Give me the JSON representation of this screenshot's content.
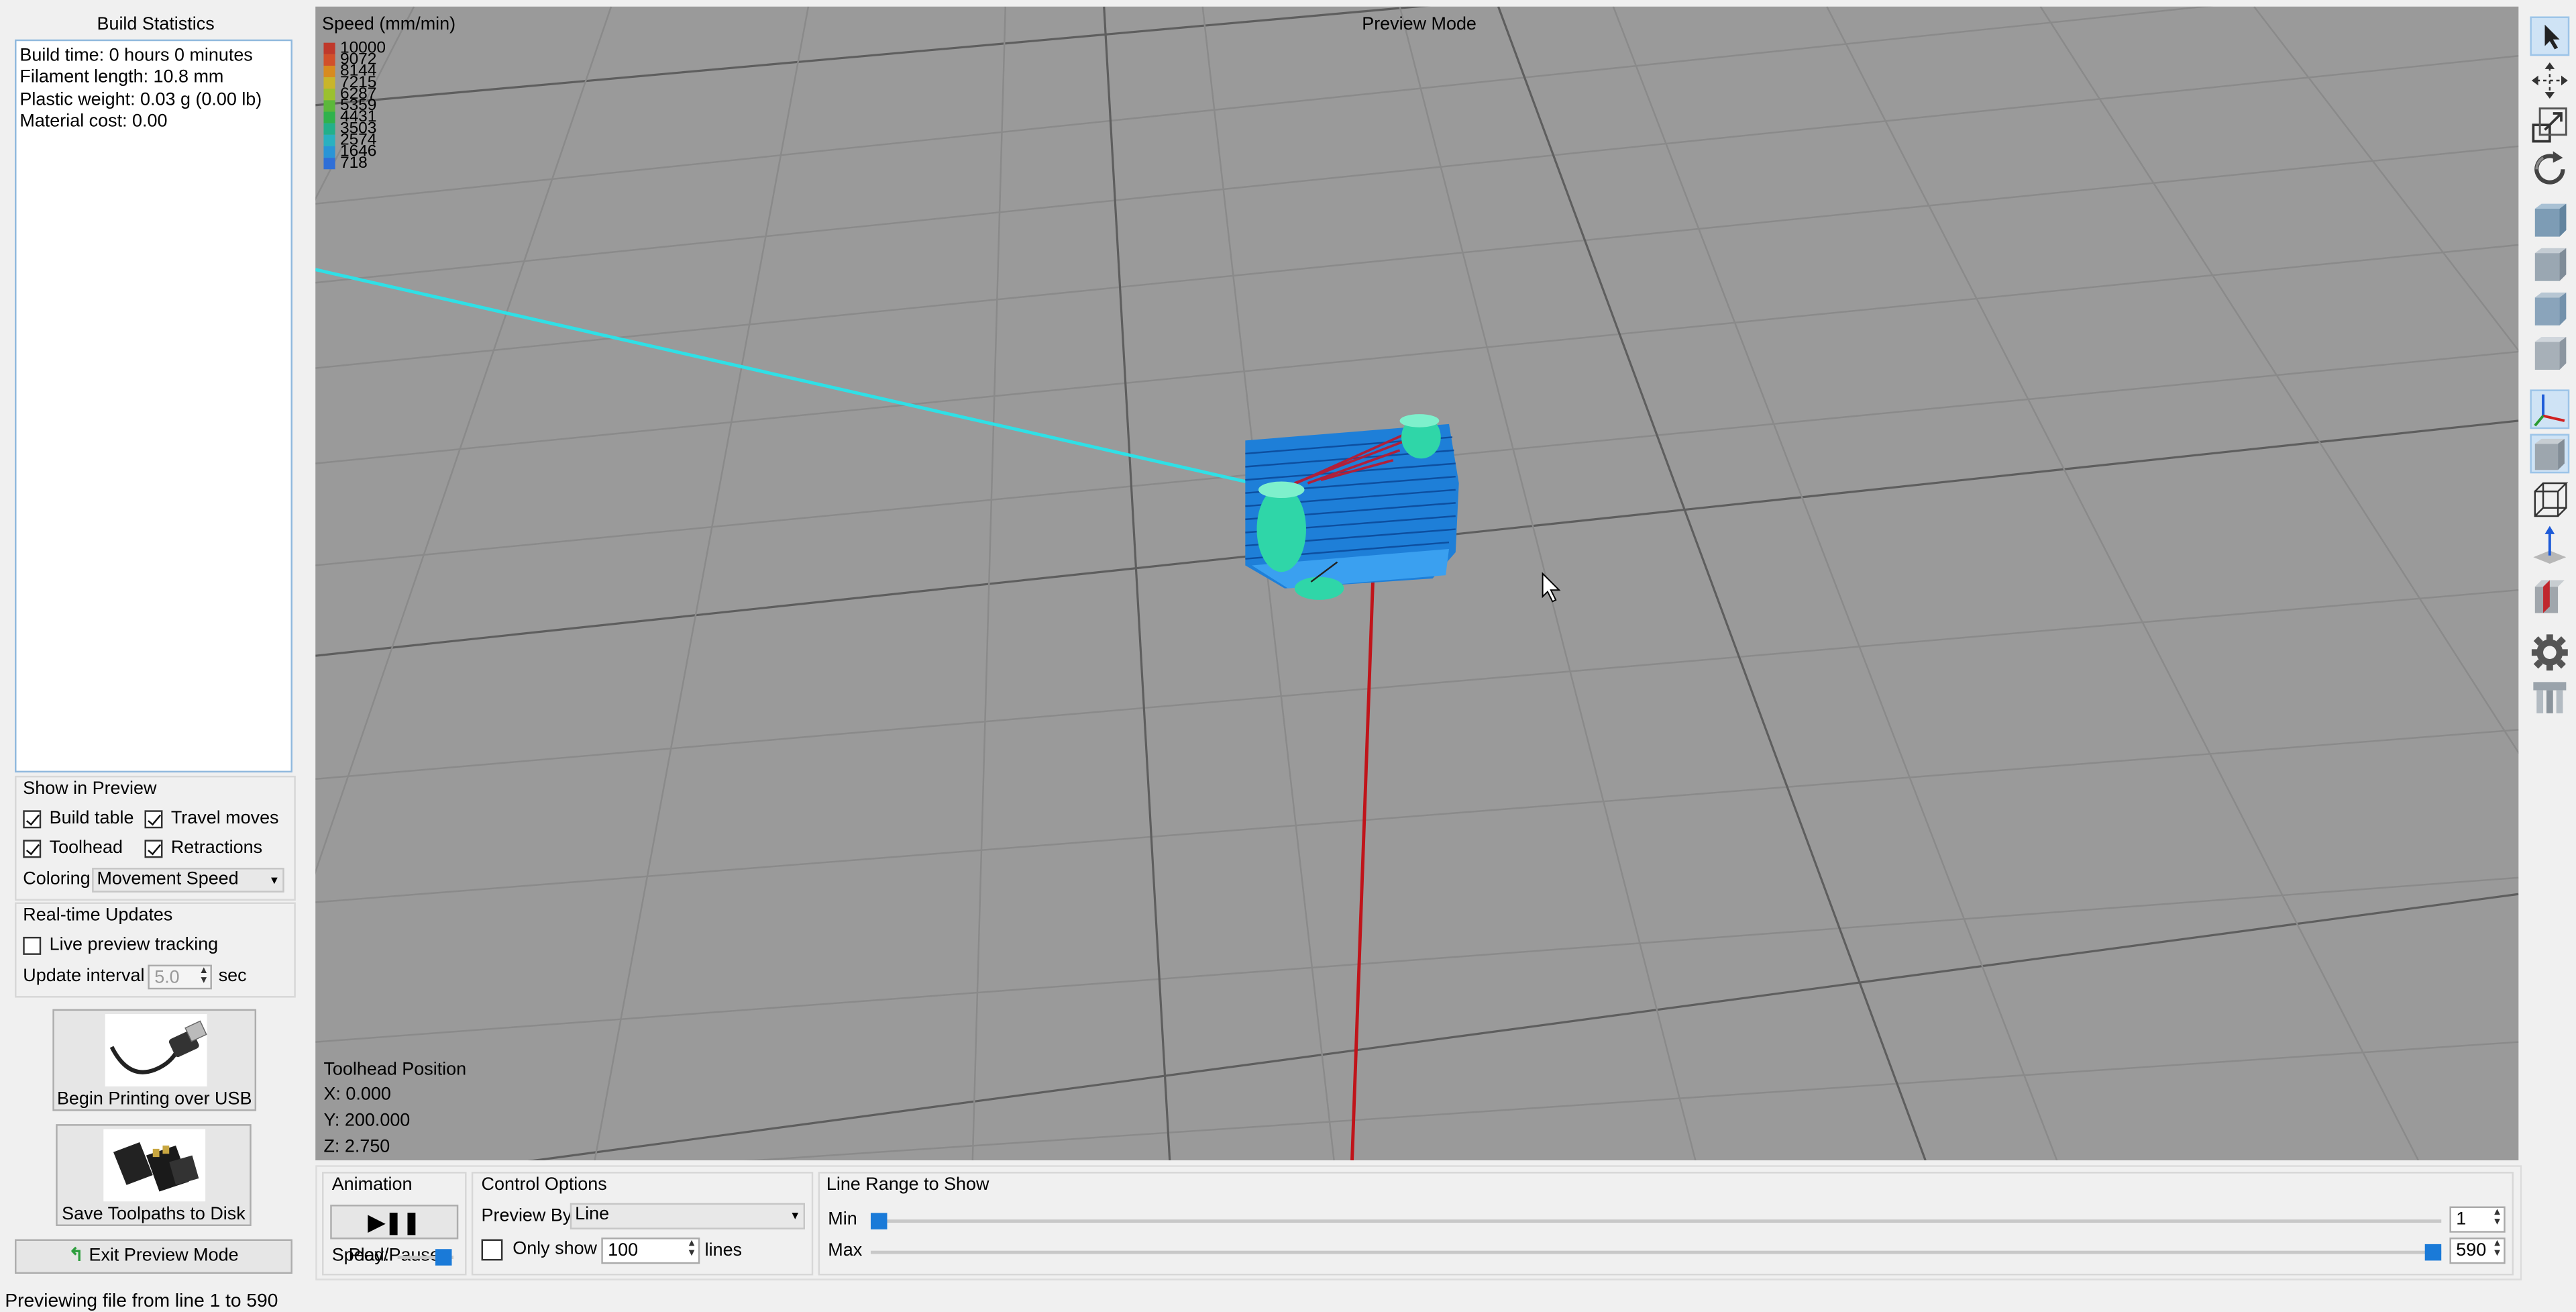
{
  "build_statistics": {
    "title": "Build Statistics",
    "lines": [
      "Build time: 0 hours 0 minutes",
      "Filament length: 10.8 mm",
      "Plastic weight: 0.03 g (0.00 lb)",
      "Material cost: 0.00"
    ]
  },
  "show_in_preview": {
    "title": "Show in Preview",
    "build_table": {
      "label": "Build table",
      "checked": true
    },
    "travel_moves": {
      "label": "Travel moves",
      "checked": true
    },
    "toolhead": {
      "label": "Toolhead",
      "checked": true
    },
    "retractions": {
      "label": "Retractions",
      "checked": true
    },
    "coloring_label": "Coloring",
    "coloring_value": "Movement Speed"
  },
  "realtime": {
    "title": "Real-time Updates",
    "live_label": "Live preview tracking",
    "live_checked": false,
    "interval_label": "Update interval",
    "interval_value": "5.0",
    "interval_unit": "sec"
  },
  "actions": {
    "usb_label": "Begin Printing over USB",
    "disk_label": "Save Toolpaths to Disk",
    "exit_label": "Exit Preview Mode"
  },
  "viewport": {
    "mode_label": "Preview Mode",
    "legend_title": "Speed (mm/min)",
    "legend": [
      {
        "label": "10000",
        "color": "#c0392b"
      },
      {
        "label": "9072",
        "color": "#d2502a"
      },
      {
        "label": "8144",
        "color": "#d88b1f"
      },
      {
        "label": "7215",
        "color": "#c9b52a"
      },
      {
        "label": "6287",
        "color": "#9bc02f"
      },
      {
        "label": "5359",
        "color": "#5cb83a"
      },
      {
        "label": "4431",
        "color": "#2fb24c"
      },
      {
        "label": "3503",
        "color": "#23b08a"
      },
      {
        "label": "2574",
        "color": "#2ab1c0"
      },
      {
        "label": "1646",
        "color": "#2a95d6"
      },
      {
        "label": "718",
        "color": "#2f6fd8"
      }
    ],
    "toolhead_title": "Toolhead Position",
    "x": "X: 0.000",
    "y": "Y: 200.000",
    "z": "Z: 2.750"
  },
  "animation": {
    "title": "Animation",
    "play_label": "Play/Pause",
    "speed_label": "Speed:"
  },
  "control_options": {
    "title": "Control Options",
    "preview_by_label": "Preview By",
    "preview_by_value": "Line",
    "only_show_label": "Only show",
    "only_show_checked": false,
    "only_show_value": "100",
    "lines_unit": "lines"
  },
  "line_range": {
    "title": "Line Range to Show",
    "min_label": "Min",
    "min_value": "1",
    "max_label": "Max",
    "max_value": "590"
  },
  "toolbar_icons": [
    "select-arrow-icon",
    "move-icon",
    "scale-icon",
    "rotate-icon",
    "view-iso-cube-icon",
    "view-front-cube-icon",
    "view-side-cube-icon",
    "view-top-cube-icon",
    "axes-icon",
    "solid-cube-icon",
    "wireframe-cube-icon",
    "z-arrow-icon",
    "cross-section-icon",
    "settings-gear-icon",
    "extruder-icon"
  ],
  "status_bar": "Previewing file from line 1 to 590"
}
